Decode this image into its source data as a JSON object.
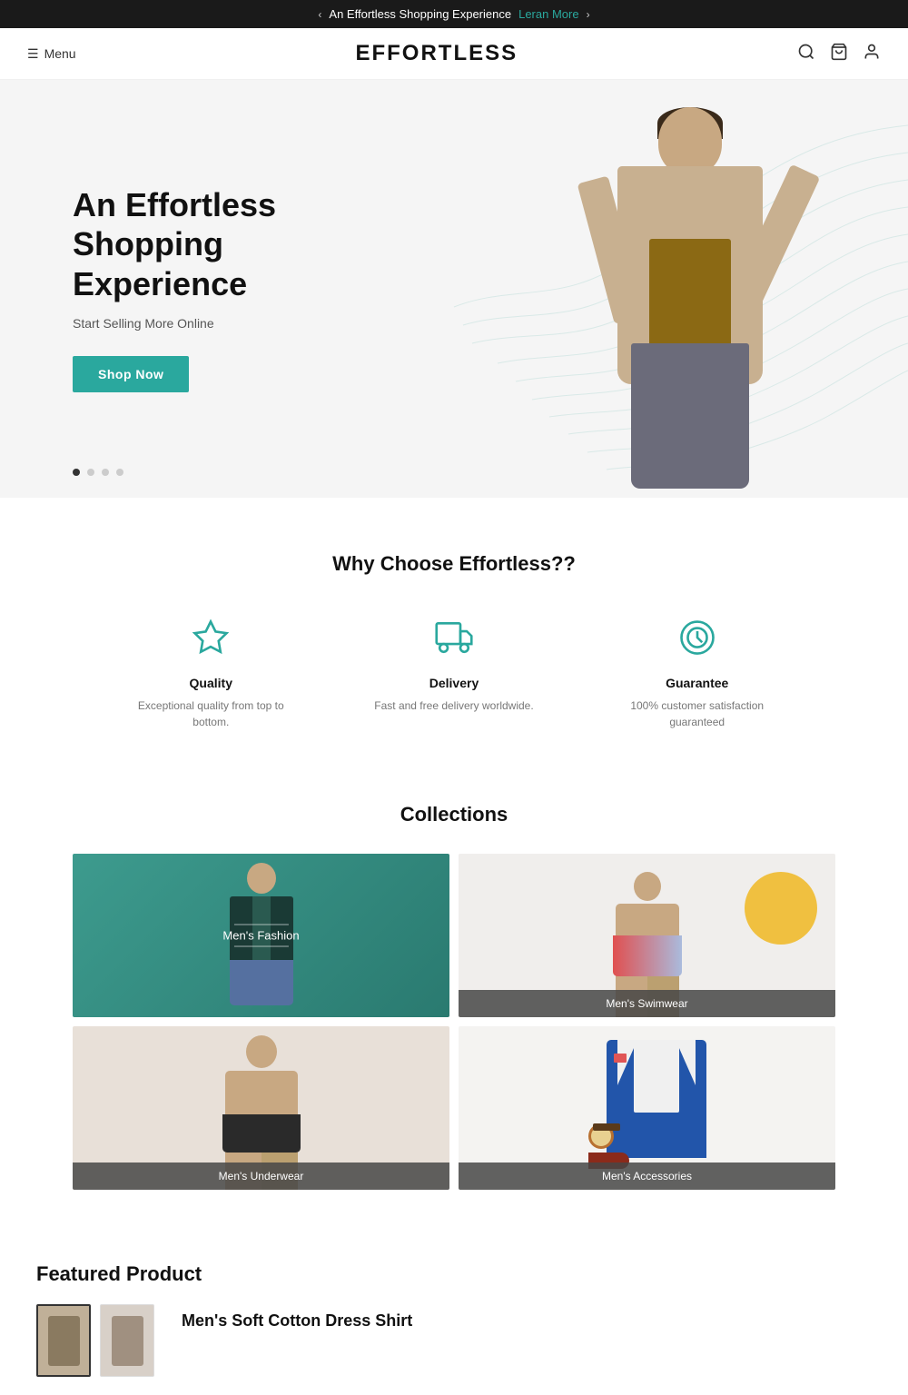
{
  "announcement": {
    "prev_arrow": "‹",
    "text": "An Effortless Shopping Experience",
    "learn_more_label": "Leran More",
    "next_arrow": "›"
  },
  "header": {
    "menu_label": "Menu",
    "logo": "EFFORTLESS"
  },
  "hero": {
    "title": "An Effortless Shopping Experience",
    "subtitle": "Start Selling More Online",
    "cta_button": "Shop Now",
    "dots": [
      {
        "active": true
      },
      {
        "active": false
      },
      {
        "active": false
      },
      {
        "active": false
      }
    ]
  },
  "why_choose": {
    "title": "Why Choose Effortless??",
    "features": [
      {
        "icon": "star-icon",
        "title": "Quality",
        "description": "Exceptional quality from top to bottom."
      },
      {
        "icon": "delivery-icon",
        "title": "Delivery",
        "description": "Fast and free delivery worldwide."
      },
      {
        "icon": "guarantee-icon",
        "title": "Guarantee",
        "description": "100% customer satisfaction guaranteed"
      }
    ]
  },
  "collections": {
    "title": "Collections",
    "items": [
      {
        "name": "Men's Fashion",
        "style": "teal",
        "center_label": true
      },
      {
        "name": "Men's Swimwear",
        "style": "light-gray",
        "center_label": false
      },
      {
        "name": "Men's Underwear",
        "style": "beige",
        "center_label": false
      },
      {
        "name": "Men's Accessories",
        "style": "white-gray",
        "center_label": false
      }
    ]
  },
  "featured": {
    "title": "Featured Product",
    "product_name": "Men's Soft Cotton Dress Shirt"
  }
}
